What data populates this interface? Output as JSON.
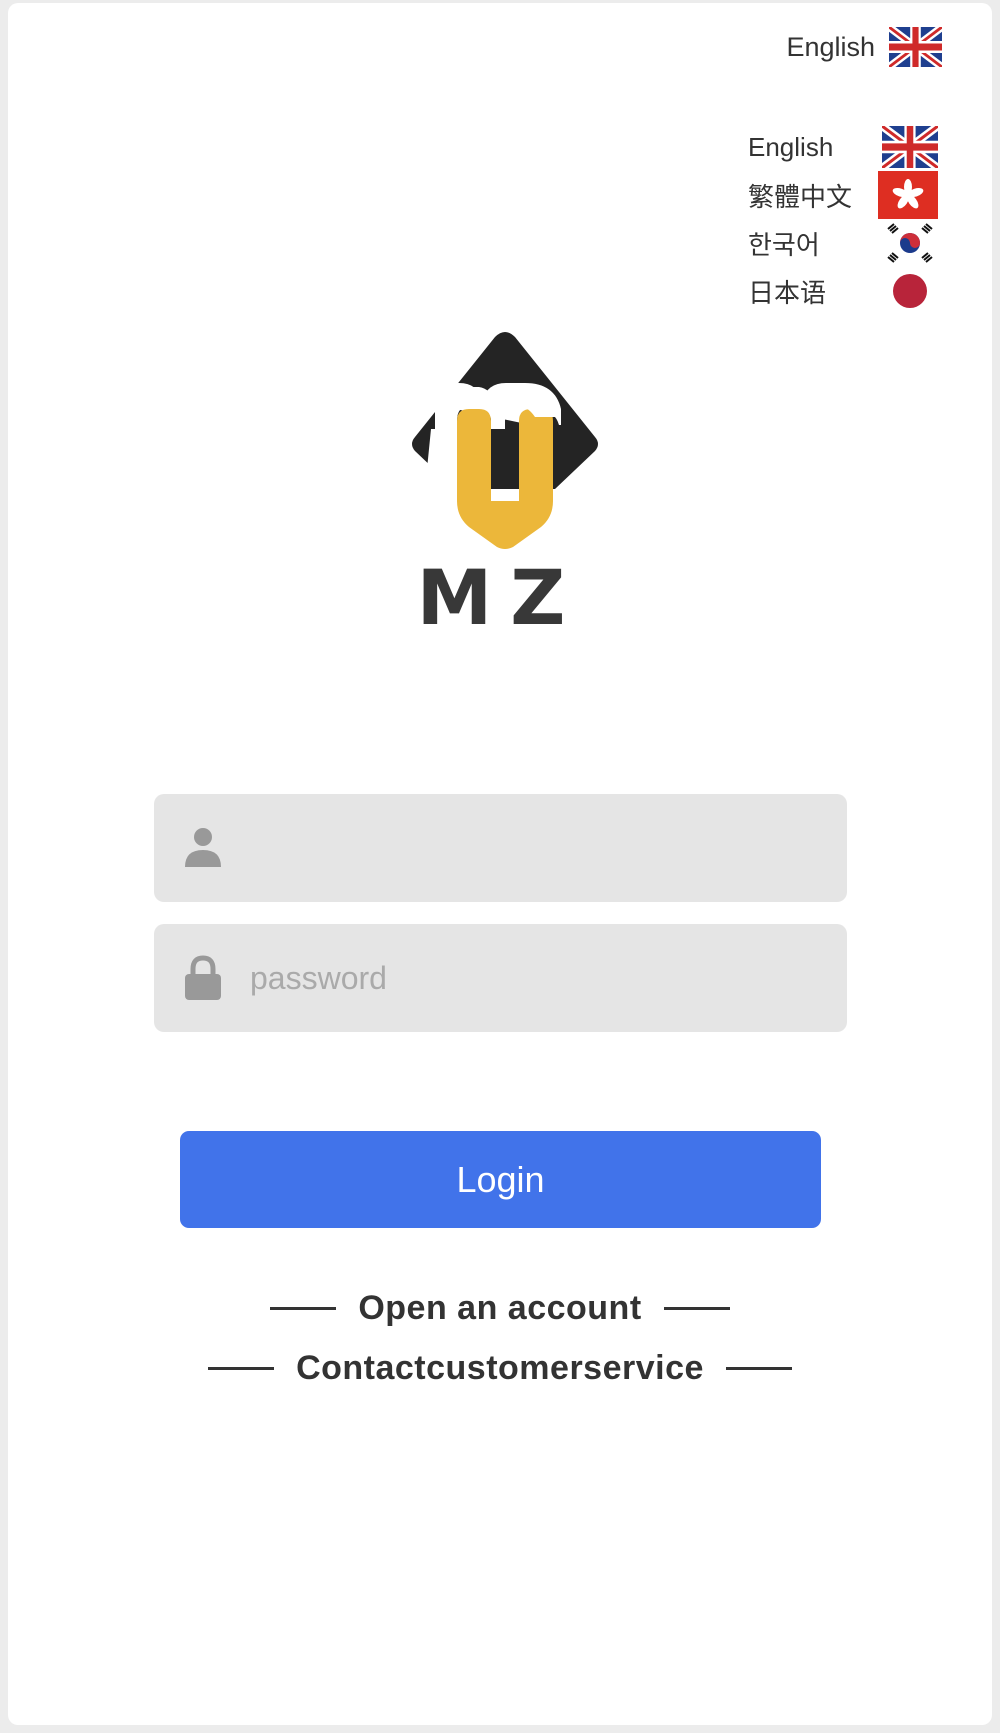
{
  "language_switcher": {
    "current_label": "English",
    "current_flag": "uk-flag-icon",
    "options": [
      {
        "label": "English",
        "flag": "uk-flag-icon"
      },
      {
        "label": "繁體中文",
        "flag": "hong-kong-flag-icon"
      },
      {
        "label": "한국어",
        "flag": "korea-flag-icon"
      },
      {
        "label": "日本语",
        "flag": "japan-flag-icon"
      }
    ]
  },
  "brand": {
    "logo_icon": "mz-logo-icon",
    "name": "MZ",
    "colors": {
      "dark": "#242424",
      "gold": "#ecb73a",
      "text": "#383838"
    }
  },
  "login_form": {
    "username": {
      "placeholder": "",
      "value": "",
      "icon": "user-icon"
    },
    "password": {
      "placeholder": "password",
      "value": "",
      "icon": "lock-icon"
    },
    "login_label": "Login",
    "accent_color": "#4173ea"
  },
  "links": {
    "open_account": "Open an account",
    "contact_service": "Contactcustomerservice"
  }
}
